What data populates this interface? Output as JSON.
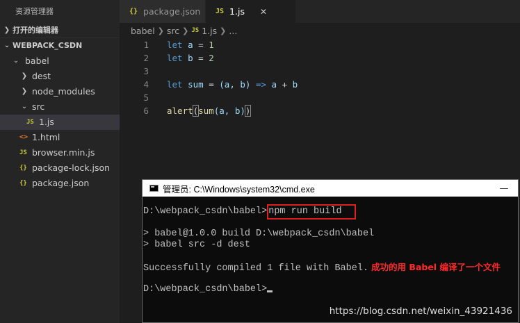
{
  "sidebar": {
    "title": "资源管理器",
    "open_editors": "打开的编辑器",
    "project": "WEBPACK_CSDN",
    "tree": [
      {
        "label": "babel",
        "icon": "chevron-down-icon"
      },
      {
        "label": "dest",
        "icon": "chevron-right-icon"
      },
      {
        "label": "node_modules",
        "icon": "chevron-right-icon"
      },
      {
        "label": "src",
        "icon": "chevron-down-icon"
      },
      {
        "label": "1.js",
        "icon": "js-file-icon",
        "icon_text": "JS"
      },
      {
        "label": "1.html",
        "icon": "html-file-icon",
        "icon_text": "<>"
      },
      {
        "label": "browser.min.js",
        "icon": "js-file-icon",
        "icon_text": "JS"
      },
      {
        "label": "package-lock.json",
        "icon": "json-file-icon",
        "icon_text": "{}"
      },
      {
        "label": "package.json",
        "icon": "json-file-icon",
        "icon_text": "{}"
      }
    ]
  },
  "tabs": [
    {
      "label": "package.json",
      "icon_text": "{}",
      "active": false
    },
    {
      "label": "1.js",
      "icon_text": "JS",
      "active": true
    }
  ],
  "breadcrumb": [
    "babel",
    "src",
    "1.js",
    "..."
  ],
  "breadcrumb_js_icon": "JS",
  "editor": {
    "lines": [
      {
        "n": "1"
      },
      {
        "n": "2"
      },
      {
        "n": "3"
      },
      {
        "n": "4"
      },
      {
        "n": "5"
      },
      {
        "n": "6"
      }
    ],
    "tokens": {
      "let": "let",
      "a": "a",
      "b": "b",
      "eq": " = ",
      "one": "1",
      "two": "2",
      "sum": "sum",
      "arrow_params": "(a, b) ",
      "arrow": "=>",
      "plus": " + ",
      "alert": "alert",
      "call_args": "(a, b)",
      "open_paren": "(",
      "close_paren": ")"
    }
  },
  "cmd": {
    "title": "管理员: C:\\Windows\\system32\\cmd.exe",
    "minimize": "—",
    "prompt1": "D:\\webpack_csdn\\babel>",
    "command": "npm run build",
    "out1": "> babel@1.0.0 build D:\\webpack_csdn\\babel",
    "out2": "> babel src -d dest",
    "success": "Successfully compiled 1 file with Babel.",
    "note": "成功的用 Babel 编译了一个文件",
    "prompt2": "D:\\webpack_csdn\\babel>"
  },
  "watermark": "https://blog.csdn.net/weixin_43921436",
  "colors": {
    "highlight_box": "#e02020",
    "note_text": "#ff2a2a",
    "keyword": "#569cd6",
    "variable": "#9cdcfe",
    "number": "#b5cea8",
    "function": "#dcdcaa"
  }
}
